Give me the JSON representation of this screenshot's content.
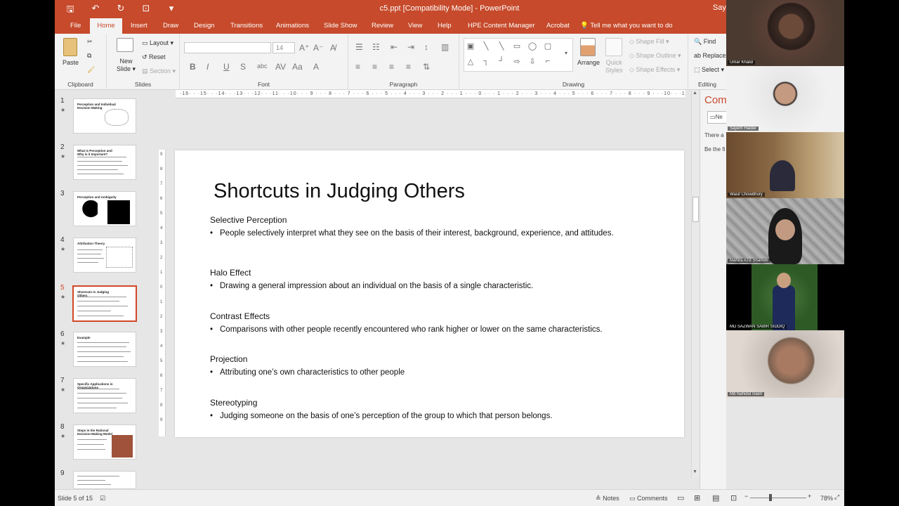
{
  "window": {
    "title": "c5.ppt [Compatibility Mode] - PowerPoint",
    "user": "Saye"
  },
  "tabs": [
    "File",
    "Home",
    "Insert",
    "Draw",
    "Design",
    "Transitions",
    "Animations",
    "Slide Show",
    "Review",
    "View",
    "Help",
    "HPE Content Manager",
    "Acrobat",
    "Tell me what you want to do"
  ],
  "ribbon": {
    "clipboard": {
      "paste": "Paste",
      "label": "Clipboard"
    },
    "slides": {
      "new_slide": "New Slide",
      "new_slide_top": "New",
      "new_slide_bottom": "Slide",
      "layout": "Layout",
      "reset": "Reset",
      "section": "Section",
      "label": "Slides"
    },
    "font": {
      "size": "14",
      "bold": "B",
      "italic": "I",
      "underline": "U",
      "strike": "S",
      "label": "Font"
    },
    "paragraph": {
      "label": "Paragraph"
    },
    "drawing": {
      "arrange": "Arrange",
      "quick_styles": "Quick Styles",
      "quick_top": "Quick",
      "quick_bottom": "Styles",
      "shape_fill": "Shape Fill",
      "shape_outline": "Shape Outline",
      "shape_effects": "Shape Effects",
      "label": "Drawing"
    },
    "editing": {
      "find": "Find",
      "replace": "Replace",
      "select": "Select",
      "label": "Editing"
    }
  },
  "thumbnails": [
    {
      "num": "1",
      "title": "Perception and Individual Decision Making"
    },
    {
      "num": "2",
      "title": "What is Perception and Why is it Important?"
    },
    {
      "num": "3",
      "title": "Perception and Ambiguity"
    },
    {
      "num": "4",
      "title": "Attribution Theory"
    },
    {
      "num": "5",
      "title": "Shortcuts in Judging Others"
    },
    {
      "num": "6",
      "title": "Example"
    },
    {
      "num": "7",
      "title": "Specific Applications in Organizations"
    },
    {
      "num": "8",
      "title": "Steps in the Rational Decision-Making Model"
    },
    {
      "num": "9",
      "title": ""
    }
  ],
  "slide": {
    "title": "Shortcuts in Judging Others",
    "sections": [
      {
        "head": "Selective Perception",
        "bullet": "People selectively interpret what they see on the basis of their interest, background, experience, and attitudes."
      },
      {
        "head": "Halo Effect",
        "bullet": "Drawing a general impression about an individual on the basis of a single characteristic."
      },
      {
        "head": "Contrast Effects",
        "bullet": "Comparisons with other people recently encountered who rank higher or lower on the same characteristics."
      },
      {
        "head": "Projection",
        "bullet": "Attributing one’s own characteristics to other people"
      },
      {
        "head": "Stereotyping",
        "bullet": "Judging someone on the basis of one’s perception of the group to which that person belongs."
      }
    ]
  },
  "ruler": {
    "horizontal": "·16· · ·15· · ·14· · ·13· · ·12· · ·11· · ·10· · · 9 · · · 8 · · · 7 · · · 6 · · · 5 · · · 4 · · · 3 · · · 2 · · · 1 · · · 0 · · · 1 · · · 2 · · · 3 · · · 4 · · · 5 · · · 6 · · · 7 · · · 8 · · · 9 · · ·10· · ·11· · ·12· · ·13· · ·14· · ·15· · ·16·",
    "vertical": [
      "9",
      "8",
      "7",
      "6",
      "5",
      "4",
      "3",
      "2",
      "1",
      "0",
      "1",
      "2",
      "3",
      "4",
      "5",
      "6",
      "7",
      "8",
      "9"
    ]
  },
  "comments_pane": {
    "header": "Com",
    "new_button": "Ne",
    "line1": "There a",
    "line2": "Be the fi"
  },
  "participants": [
    "Umar Khalid",
    "Sayem Haider",
    "Wasif Chowdhury",
    "Mahira Aziz Shamim",
    "MD SAZWAN SABIR SIDDIQ",
    "Md Nahidul Islam"
  ],
  "status": {
    "slide_of": "Slide 5 of 15",
    "notes": "Notes",
    "comments": "Comments",
    "zoom": "78%"
  }
}
